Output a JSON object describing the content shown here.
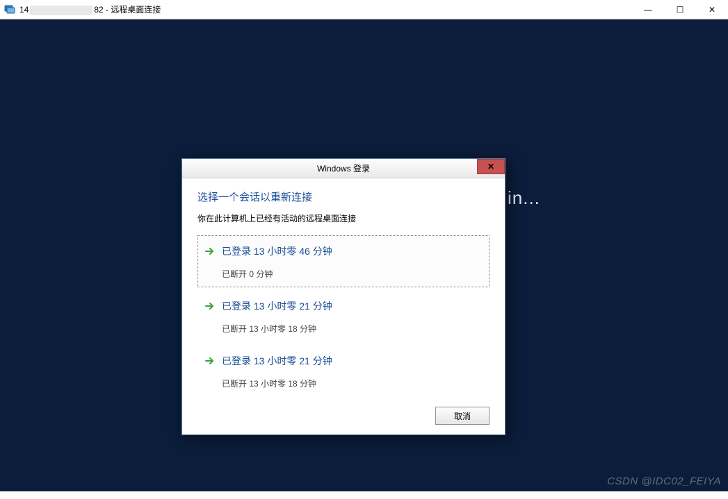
{
  "outer": {
    "title_prefix": "14",
    "title_suffix": "82 - 远程桌面连接",
    "minimize": "—",
    "maximize": "☐",
    "close": "✕"
  },
  "background_text": "in...",
  "dialog": {
    "title": "Windows 登录",
    "close_label": "✕",
    "heading": "选择一个会话以重新连接",
    "subtext": "你在此计算机上已经有活动的远程桌面连接",
    "sessions": [
      {
        "title": "已登录 13 小时零 46 分钟",
        "detail": "已断开 0 分钟",
        "selected": true
      },
      {
        "title": "已登录 13 小时零 21 分钟",
        "detail": "已断开 13 小时零 18 分钟",
        "selected": false
      },
      {
        "title": "已登录 13 小时零 21 分钟",
        "detail": "已断开 13 小时零 18 分钟",
        "selected": false
      }
    ],
    "cancel": "取消"
  },
  "watermark": "CSDN @IDC02_FEIYA"
}
